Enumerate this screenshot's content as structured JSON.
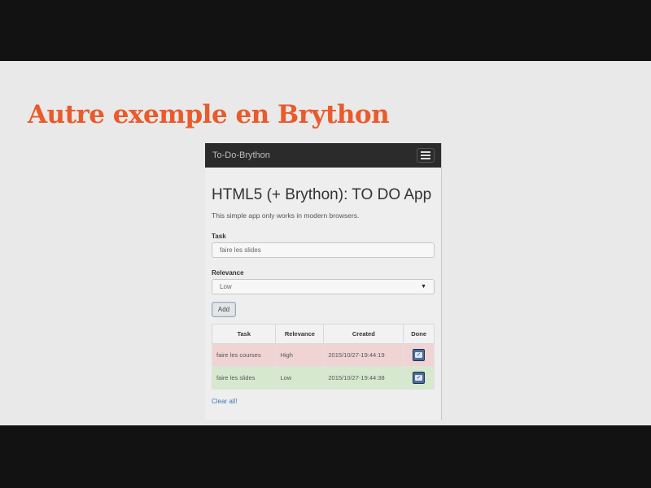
{
  "slide": {
    "title": "Autre exemple en Brython"
  },
  "app": {
    "navbar": {
      "brand": "To-Do-Brython"
    },
    "heading": "HTML5 (+ Brython): TO DO App",
    "lead": "This simple app only works in modern browsers.",
    "form": {
      "task_label": "Task",
      "task_value": "faire les slides",
      "relevance_label": "Relevance",
      "relevance_value": "Low",
      "add_label": "Add"
    },
    "table": {
      "headers": [
        "Task",
        "Relevance",
        "Created",
        "Done"
      ],
      "rows": [
        {
          "task": "faire les courses",
          "relevance": "High",
          "created": "2015/10/27-19:44:19",
          "row_color": "#f0d4d4"
        },
        {
          "task": "faire les slides",
          "relevance": "Low",
          "created": "2015/10/27-19:44:38",
          "row_color": "#d6e9cf"
        }
      ]
    },
    "clear_label": "Clear all!",
    "colors": {
      "slide_title": "#ea5a2b",
      "navbar": "#2b2b2b",
      "link": "#3a78b8"
    }
  }
}
